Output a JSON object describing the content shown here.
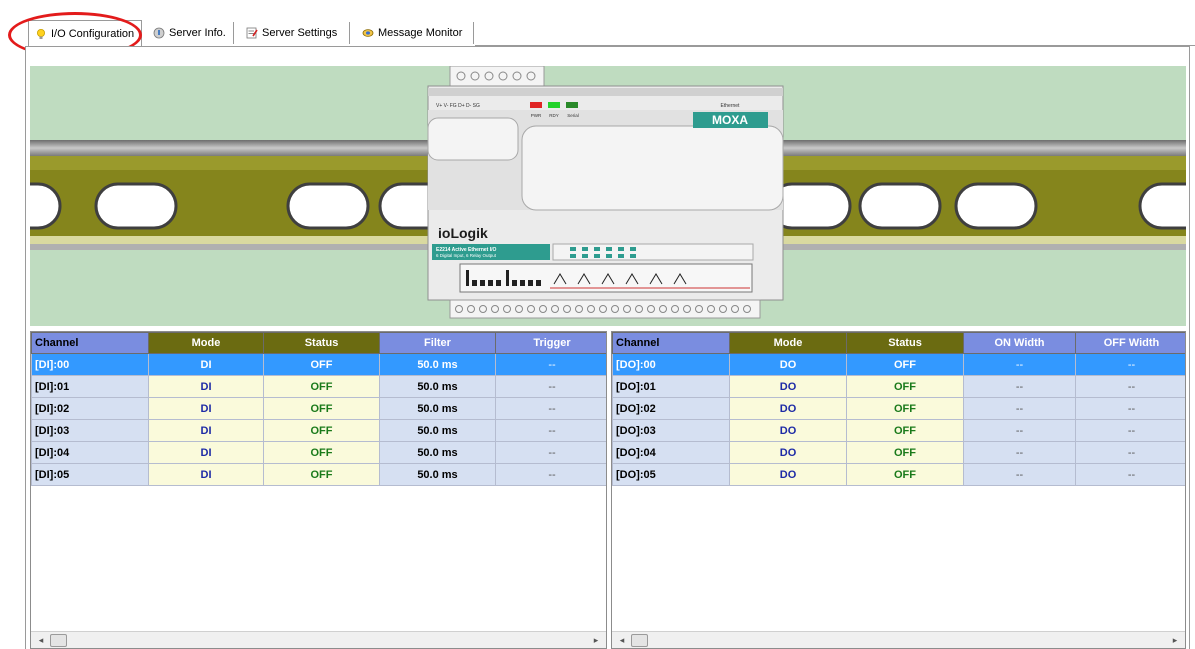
{
  "tabs": [
    {
      "label": "I/O Configuration",
      "icon": "lightbulb-icon"
    },
    {
      "label": "Server Info.",
      "icon": "server-icon"
    },
    {
      "label": "Server Settings",
      "icon": "settings-icon"
    },
    {
      "label": "Message Monitor",
      "icon": "monitor-icon"
    }
  ],
  "device": {
    "brand": "ioLogik",
    "vendor": "MOXA",
    "model_line1": "E2214 Active Ethernet I/O",
    "model_line2": "6 Digital Input, 6 Relay Output",
    "terminal_labels": "V+  V-  FG  D+  D-  SG",
    "led_labels": [
      "PWR",
      "RDY",
      "Serial"
    ],
    "ethernet_label": "Ethernet"
  },
  "di_table": {
    "headers": [
      "Channel",
      "Mode",
      "Status",
      "Filter",
      "Trigger"
    ],
    "rows": [
      [
        "[DI]:00",
        "DI",
        "OFF",
        "50.0 ms",
        "--"
      ],
      [
        "[DI]:01",
        "DI",
        "OFF",
        "50.0 ms",
        "--"
      ],
      [
        "[DI]:02",
        "DI",
        "OFF",
        "50.0 ms",
        "--"
      ],
      [
        "[DI]:03",
        "DI",
        "OFF",
        "50.0 ms",
        "--"
      ],
      [
        "[DI]:04",
        "DI",
        "OFF",
        "50.0 ms",
        "--"
      ],
      [
        "[DI]:05",
        "DI",
        "OFF",
        "50.0 ms",
        "--"
      ]
    ]
  },
  "do_table": {
    "headers": [
      "Channel",
      "Mode",
      "Status",
      "ON Width",
      "OFF Width"
    ],
    "rows": [
      [
        "[DO]:00",
        "DO",
        "OFF",
        "--",
        "--"
      ],
      [
        "[DO]:01",
        "DO",
        "OFF",
        "--",
        "--"
      ],
      [
        "[DO]:02",
        "DO",
        "OFF",
        "--",
        "--"
      ],
      [
        "[DO]:03",
        "DO",
        "OFF",
        "--",
        "--"
      ],
      [
        "[DO]:04",
        "DO",
        "OFF",
        "--",
        "--"
      ],
      [
        "[DO]:05",
        "DO",
        "OFF",
        "--",
        "--"
      ]
    ]
  },
  "colors": {
    "header_blue": "#7a8de0",
    "header_olive": "#6b6b11",
    "selected_row": "#3399ff",
    "highlight_ring": "#e31b1b",
    "rail_green": "#8a8a1e",
    "banner_bg": "#bfdcc0"
  }
}
